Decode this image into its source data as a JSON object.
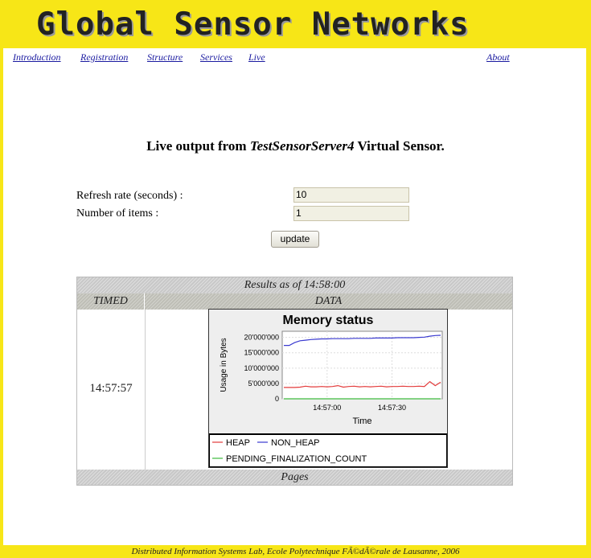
{
  "site": {
    "title": "Global Sensor Networks"
  },
  "nav": {
    "items": [
      "Introduction",
      "Registration",
      "Structure",
      "Services",
      "Live"
    ],
    "about": "About"
  },
  "main": {
    "heading_prefix": "Live output from",
    "sensor_name": "TestSensorServer4",
    "heading_suffix": "Virtual Sensor."
  },
  "form": {
    "refresh_label": "Refresh rate (seconds) :",
    "refresh_value": "10",
    "items_label": "Number of items :",
    "items_value": "1",
    "update_label": "update"
  },
  "results": {
    "caption": "Results as of 14:58:00",
    "col_timed": "TIMED",
    "col_data": "DATA",
    "row_time": "14:57:57",
    "pages_label": "Pages"
  },
  "chart_data": {
    "type": "line",
    "title": "Memory status",
    "xlabel": "Time",
    "ylabel": "Usage in Bytes",
    "x_ticks": [
      "14:57:00",
      "14:57:30"
    ],
    "y_ticks": [
      "0",
      "5'000'000",
      "10'000'000",
      "15'000'000",
      "20'000'000"
    ],
    "ylim": [
      0,
      22000000
    ],
    "x": [
      0,
      1,
      2,
      3,
      4,
      5,
      6,
      7,
      8,
      9,
      10,
      11,
      12,
      13,
      14,
      15,
      16,
      17,
      18,
      19,
      20,
      21,
      22,
      23,
      24,
      25,
      26,
      27,
      28,
      29
    ],
    "series": [
      {
        "name": "HEAP",
        "color": "#e33b3b",
        "values": [
          3700000,
          3700000,
          3700000,
          3800000,
          4100000,
          3900000,
          3900000,
          4000000,
          3900000,
          4000000,
          4300000,
          3800000,
          4000000,
          4100000,
          3900000,
          4000000,
          3900000,
          4000000,
          4100000,
          3900000,
          4000000,
          4000000,
          4100000,
          4000000,
          4000000,
          4100000,
          4000000,
          5600000,
          4300000,
          5400000
        ]
      },
      {
        "name": "NON_HEAP",
        "color": "#3a3ad0",
        "values": [
          17400000,
          17400000,
          18300000,
          18900000,
          19100000,
          19300000,
          19400000,
          19500000,
          19500000,
          19600000,
          19600000,
          19600000,
          19600000,
          19700000,
          19700000,
          19700000,
          19700000,
          19800000,
          19800000,
          19800000,
          19800000,
          19900000,
          19900000,
          19900000,
          19900000,
          20000000,
          20100000,
          20400000,
          20600000,
          20700000
        ]
      },
      {
        "name": "PENDING_FINALIZATION_COUNT",
        "color": "#3dbb3d",
        "values": [
          0,
          0,
          0,
          0,
          0,
          0,
          0,
          0,
          0,
          0,
          0,
          0,
          0,
          0,
          0,
          0,
          0,
          0,
          0,
          0,
          0,
          0,
          0,
          0,
          0,
          0,
          0,
          0,
          0,
          0
        ]
      }
    ]
  },
  "footer": {
    "text": "Distributed Information Systems Lab, Ecole Polytechnique FÃ©dÃ©rale de Lausanne, 2006"
  }
}
